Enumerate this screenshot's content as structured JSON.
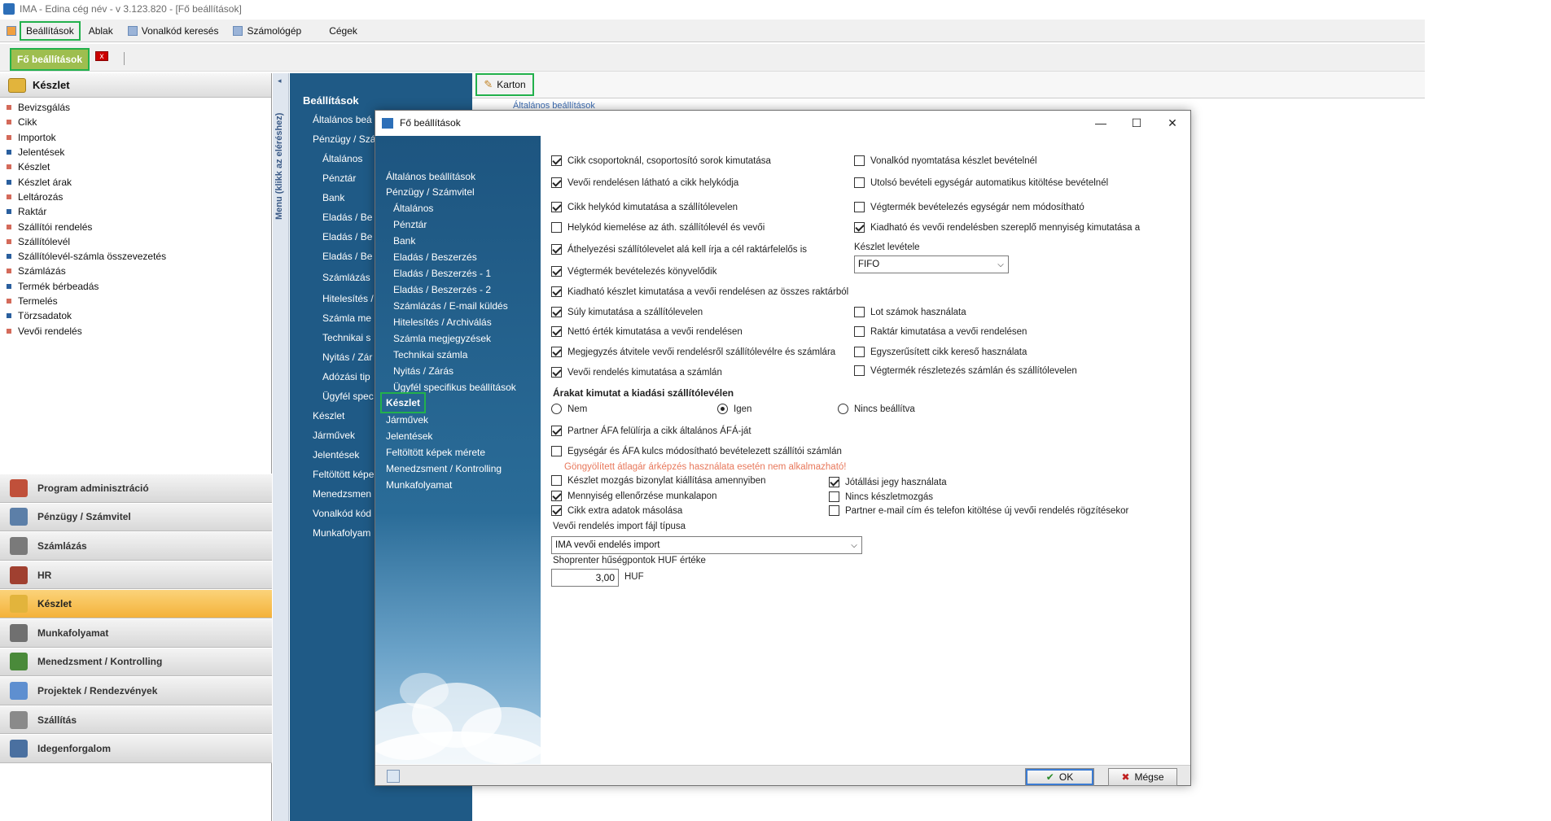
{
  "window": {
    "title": "IMA - Edina cég név - v 3.123.820 - [Fő beállítások]"
  },
  "menu": {
    "items": [
      "Beállítások",
      "Ablak",
      "Vonalkód keresés",
      "Számológép",
      "Cégek"
    ]
  },
  "tabs": {
    "active": "Fő beállítások",
    "close": "x"
  },
  "leftpanel": {
    "header": "Készlet",
    "items": [
      "Bevizsgálás",
      "Cikk",
      "Importok",
      "Jelentések",
      "Készlet",
      "Készlet árak",
      "Leltározás",
      "Raktár",
      "Szállítói rendelés",
      "Szállítólevél",
      "Szállítólevél-számla összevezetés",
      "Számlázás",
      "Termék bérbeadás",
      "Termelés",
      "Törzsadatok",
      "Vevői rendelés"
    ],
    "modules": [
      "Program adminisztráció",
      "Pénzügy / Számvitel",
      "Számlázás",
      "HR",
      "Készlet",
      "Munkafolyamat",
      "Menedzsment / Kontrolling",
      "Projektek / Rendezvények",
      "Szállítás",
      "Idegenforgalom"
    ]
  },
  "vstrip": {
    "label": "Menu (klikk az eléréshez)"
  },
  "nav2": {
    "header": "Beállítások",
    "items": [
      "Általános beá",
      "Pénzügy / Szá",
      "Általános",
      "Pénztár",
      "Bank",
      "Eladás / Be",
      "Eladás / Be",
      "Eladás / Be",
      "Számlázás",
      "Hitelesítés /",
      "Számla me",
      "Technikai s",
      "Nyitás / Zár",
      "Adózási tip",
      "Ügyfél spec",
      "Készlet",
      "Járművek",
      "Jelentések",
      "Feltöltött képe",
      "Menedzsmen",
      "Vonalkód kód",
      "Munkafolyam"
    ]
  },
  "karton": {
    "label": "Karton",
    "behind": "Általános beállítások"
  },
  "dialog": {
    "title": "Fő beállítások",
    "controls": {
      "minimize": "—",
      "maximize": "☐",
      "close": "✕"
    },
    "nav": [
      "Általános beállítások",
      "Pénzügy / Számvitel",
      "Általános",
      "Pénztár",
      "Bank",
      "Eladás / Beszerzés",
      "Eladás / Beszerzés - 1",
      "Eladás / Beszerzés - 2",
      "Számlázás / E-mail küldés",
      "Hitelesítés / Archiválás",
      "Számla megjegyzések",
      "Technikai számla",
      "Nyitás / Zárás",
      "Ügyfél specifikus beállítások",
      "Készlet",
      "Járművek",
      "Jelentések",
      "Feltöltött képek mérete",
      "Menedzsment / Kontrolling",
      "Munkafolyamat"
    ],
    "left_checks": [
      {
        "label": "Cikk csoportoknál, csoportosító sorok kimutatása",
        "checked": true
      },
      {
        "label": "Vevői rendelésen látható a cikk helykódja",
        "checked": true
      },
      {
        "label": "Cikk helykód kimutatása a szállítólevelen",
        "checked": true
      },
      {
        "label": "Helykód kiemelése az áth. szállítólevél és vevői",
        "checked": false
      },
      {
        "label": "Áthelyezési szállítólevelet alá kell írja a cél raktárfelelős is",
        "checked": true
      },
      {
        "label": "Végtermék bevételezés könyvelődik",
        "checked": true
      },
      {
        "label": "Kiadható készlet kimutatása a vevői rendelésen az összes raktárból",
        "checked": true
      },
      {
        "label": "Súly kimutatása a szállítólevelen",
        "checked": true
      },
      {
        "label": "Nettó érték kimutatása a vevői rendelésen",
        "checked": true
      },
      {
        "label": "Megjegyzés átvitele vevői rendelésről szállítólevélre és számlára",
        "checked": true
      },
      {
        "label": "Vevői rendelés kimutatása a számlán",
        "checked": true
      }
    ],
    "right_checks": [
      {
        "label": "Vonalkód nyomtatása készlet bevételnél",
        "checked": false
      },
      {
        "label": "Utolsó bevételi egységár automatikus kitöltése bevételnél",
        "checked": false
      },
      {
        "label": "Végtermék bevételezés egységár nem módosítható",
        "checked": false
      },
      {
        "label": "Kiadható és vevői rendelésben szereplő mennyiség kimutatása a",
        "checked": true
      },
      {
        "label": "Lot számok használata",
        "checked": false
      },
      {
        "label": "Raktár kimutatása a vevői rendelésen",
        "checked": false
      },
      {
        "label": "Egyszerűsített cikk kereső használata",
        "checked": false
      },
      {
        "label": "Végtermék részletezés számlán és szállítólevelen",
        "checked": false
      }
    ],
    "stock_label": "Készlet levétele",
    "stock_value": "FIFO",
    "price_heading": "Árakat kimutat a kiadási szállítólevélen",
    "radios": [
      {
        "label": "Nem",
        "checked": false
      },
      {
        "label": "Igen",
        "checked": true
      },
      {
        "label": "Nincs beállítva",
        "checked": false
      }
    ],
    "check_partner": {
      "label": "Partner ÁFA felülírja a cikk általános ÁFÁ-ját",
      "checked": true
    },
    "check_unit": {
      "label": "Egységár és ÁFA kulcs módosítható bevételezett szállítói számlán",
      "checked": false
    },
    "warning": "Göngyölített átlagár árképzés használata esetén nem alkalmazható!",
    "bottom_left": [
      {
        "label": "Készlet mozgás bizonylat kiállítása amennyiben",
        "checked": false
      },
      {
        "label": "Mennyiség ellenőrzése munkalapon",
        "checked": true
      },
      {
        "label": "Cikk extra adatok másolása",
        "checked": true
      }
    ],
    "bottom_right": [
      {
        "label": "Jótállási jegy használata",
        "checked": true
      },
      {
        "label": "Nincs készletmozgás",
        "checked": false
      },
      {
        "label": "Partner e-mail cím és telefon kitöltése új vevői rendelés rögzítésekor",
        "checked": false
      }
    ],
    "import_label": "Vevői rendelés import fájl típusa",
    "import_value": "IMA vevői endelés import",
    "points_label": "Shoprenter hűségpontok HUF értéke",
    "points_value": "3,00",
    "points_unit": "HUF",
    "ok": "OK",
    "cancel": "Mégse"
  }
}
